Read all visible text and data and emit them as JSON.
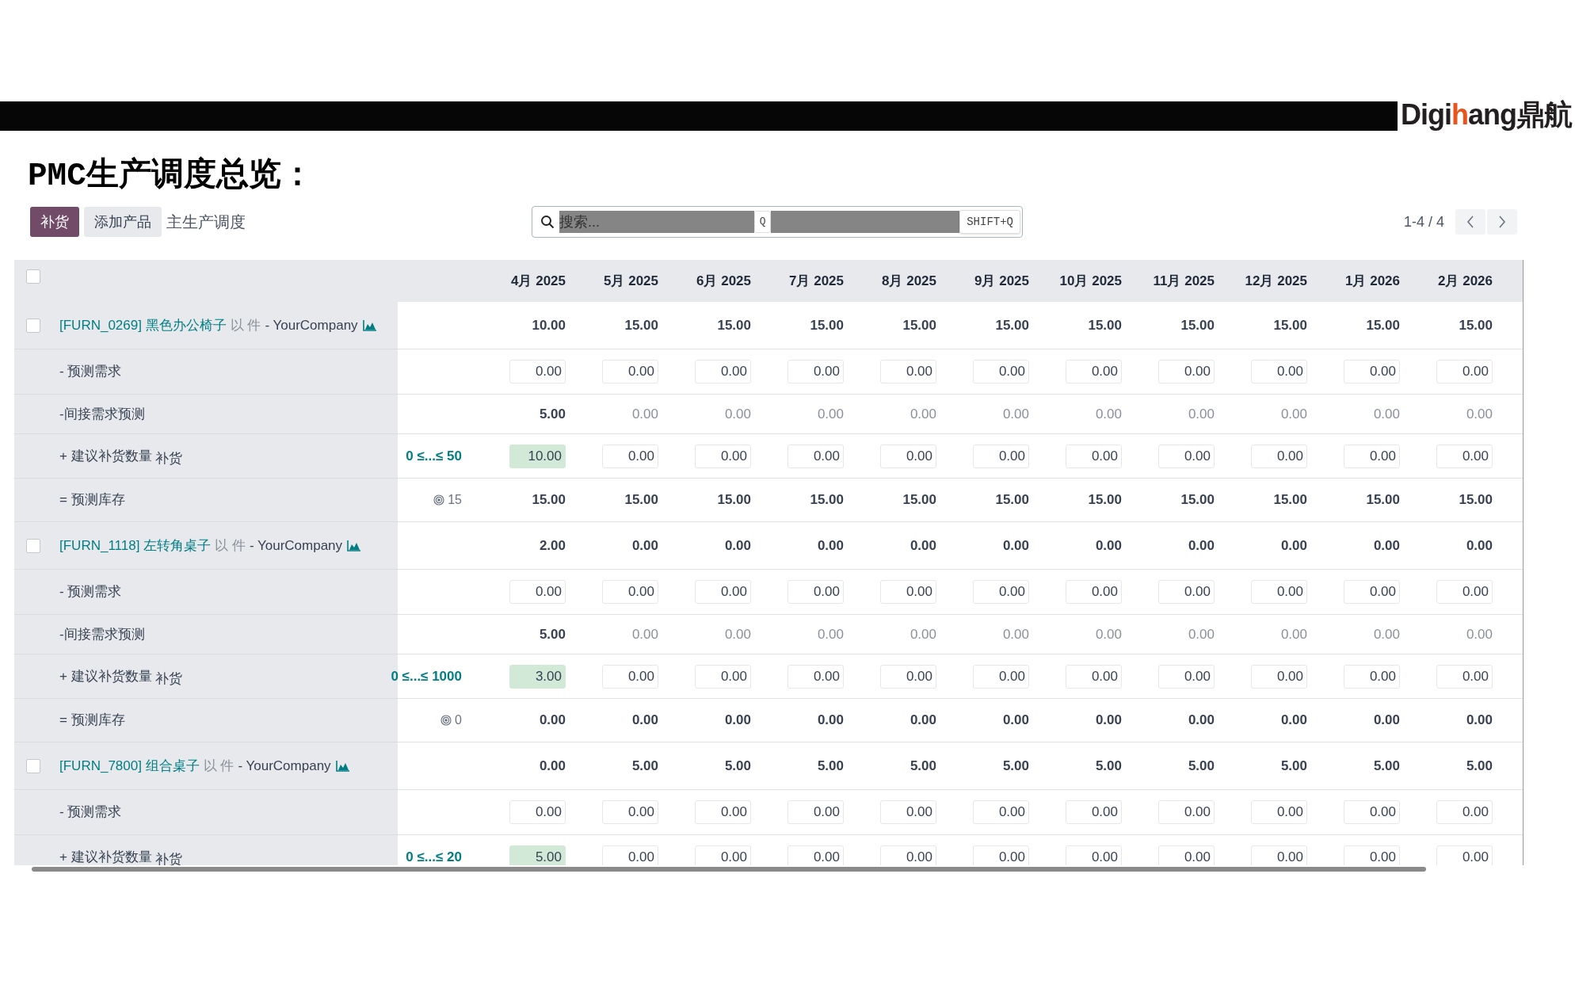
{
  "logo": {
    "parts": [
      {
        "text": "Digi",
        "color": "#231f20"
      },
      {
        "text": "h",
        "color": "#e8541c"
      },
      {
        "text": "ang",
        "color": "#231f20"
      },
      {
        "text": "鼎航",
        "color": "#231f20"
      }
    ]
  },
  "title": "PMC生产调度总览：",
  "toolbar": {
    "buttons": [
      {
        "label": "补货",
        "kind": "primary"
      },
      {
        "label": "添加产品",
        "kind": "secondary"
      }
    ],
    "breadcrumb": "主生产调度"
  },
  "search": {
    "placeholder": "搜索...",
    "key_hint": "Q",
    "shortcut": "SHIFT+Q"
  },
  "pager": {
    "range": "1-4 / 4"
  },
  "table": {
    "select_all_checked": false,
    "columns": [
      "4月 2025",
      "5月 2025",
      "6月 2025",
      "7月 2025",
      "8月 2025",
      "9月 2025",
      "10月 2025",
      "11月 2025",
      "12月 2025",
      "1月 2026",
      "2月 2026"
    ],
    "products": [
      {
        "code": "[FURN_0269]",
        "name": "黑色办公椅子",
        "uom": "以 件",
        "company": "- YourCompany",
        "checked": false,
        "values": [
          "10.00",
          "15.00",
          "15.00",
          "15.00",
          "15.00",
          "15.00",
          "15.00",
          "15.00",
          "15.00",
          "15.00",
          "15.00"
        ],
        "rows": [
          {
            "kind": "demand",
            "label": "- 预测需求",
            "cells": [
              {
                "text": "0.00"
              },
              {
                "text": "0.00"
              },
              {
                "text": "0.00"
              },
              {
                "text": "0.00"
              },
              {
                "text": "0.00"
              },
              {
                "text": "0.00"
              },
              {
                "text": "0.00"
              },
              {
                "text": "0.00"
              },
              {
                "text": "0.00"
              },
              {
                "text": "0.00"
              },
              {
                "text": "0.00"
              }
            ]
          },
          {
            "kind": "indirect",
            "label": "-间接需求预测",
            "cells": [
              {
                "text": "5.00",
                "muted": false
              },
              {
                "text": "0.00",
                "muted": true
              },
              {
                "text": "0.00",
                "muted": true
              },
              {
                "text": "0.00",
                "muted": true
              },
              {
                "text": "0.00",
                "muted": true
              },
              {
                "text": "0.00",
                "muted": true
              },
              {
                "text": "0.00",
                "muted": true
              },
              {
                "text": "0.00",
                "muted": true
              },
              {
                "text": "0.00",
                "muted": true
              },
              {
                "text": "0.00",
                "muted": true
              },
              {
                "text": "0.00",
                "muted": true
              }
            ]
          },
          {
            "kind": "replenish",
            "label": "+ 建议补货数量",
            "action": "补货",
            "range": "0 ≤...≤ 50",
            "cells": [
              {
                "text": "10.00",
                "highlighted": true
              },
              {
                "text": "0.00",
                "highlighted": false
              },
              {
                "text": "0.00",
                "highlighted": false
              },
              {
                "text": "0.00",
                "highlighted": false
              },
              {
                "text": "0.00",
                "highlighted": false
              },
              {
                "text": "0.00",
                "highlighted": false
              },
              {
                "text": "0.00",
                "highlighted": false
              },
              {
                "text": "0.00",
                "highlighted": false
              },
              {
                "text": "0.00",
                "highlighted": false
              },
              {
                "text": "0.00",
                "highlighted": false
              },
              {
                "text": "0.00",
                "highlighted": false
              }
            ]
          },
          {
            "kind": "forecast",
            "label": "= 预测库存",
            "safety_stock": "15",
            "cells": [
              {
                "text": "15.00"
              },
              {
                "text": "15.00"
              },
              {
                "text": "15.00"
              },
              {
                "text": "15.00"
              },
              {
                "text": "15.00"
              },
              {
                "text": "15.00"
              },
              {
                "text": "15.00"
              },
              {
                "text": "15.00"
              },
              {
                "text": "15.00"
              },
              {
                "text": "15.00"
              },
              {
                "text": "15.00"
              }
            ]
          }
        ]
      },
      {
        "code": "[FURN_1118]",
        "name": "左转角桌子",
        "uom": "以 件",
        "company": "- YourCompany",
        "checked": false,
        "values": [
          "2.00",
          "0.00",
          "0.00",
          "0.00",
          "0.00",
          "0.00",
          "0.00",
          "0.00",
          "0.00",
          "0.00",
          "0.00"
        ],
        "rows": [
          {
            "kind": "demand",
            "label": "- 预测需求",
            "cells": [
              {
                "text": "0.00"
              },
              {
                "text": "0.00"
              },
              {
                "text": "0.00"
              },
              {
                "text": "0.00"
              },
              {
                "text": "0.00"
              },
              {
                "text": "0.00"
              },
              {
                "text": "0.00"
              },
              {
                "text": "0.00"
              },
              {
                "text": "0.00"
              },
              {
                "text": "0.00"
              },
              {
                "text": "0.00"
              }
            ]
          },
          {
            "kind": "indirect",
            "label": "-间接需求预测",
            "cells": [
              {
                "text": "5.00",
                "muted": false
              },
              {
                "text": "0.00",
                "muted": true
              },
              {
                "text": "0.00",
                "muted": true
              },
              {
                "text": "0.00",
                "muted": true
              },
              {
                "text": "0.00",
                "muted": true
              },
              {
                "text": "0.00",
                "muted": true
              },
              {
                "text": "0.00",
                "muted": true
              },
              {
                "text": "0.00",
                "muted": true
              },
              {
                "text": "0.00",
                "muted": true
              },
              {
                "text": "0.00",
                "muted": true
              },
              {
                "text": "0.00",
                "muted": true
              }
            ]
          },
          {
            "kind": "replenish",
            "label": "+ 建议补货数量",
            "action": "补货",
            "range": "0 ≤...≤ 1000",
            "cells": [
              {
                "text": "3.00",
                "highlighted": true
              },
              {
                "text": "0.00",
                "highlighted": false
              },
              {
                "text": "0.00",
                "highlighted": false
              },
              {
                "text": "0.00",
                "highlighted": false
              },
              {
                "text": "0.00",
                "highlighted": false
              },
              {
                "text": "0.00",
                "highlighted": false
              },
              {
                "text": "0.00",
                "highlighted": false
              },
              {
                "text": "0.00",
                "highlighted": false
              },
              {
                "text": "0.00",
                "highlighted": false
              },
              {
                "text": "0.00",
                "highlighted": false
              },
              {
                "text": "0.00",
                "highlighted": false
              }
            ]
          },
          {
            "kind": "forecast",
            "label": "= 预测库存",
            "safety_stock": "0",
            "cells": [
              {
                "text": "0.00"
              },
              {
                "text": "0.00"
              },
              {
                "text": "0.00"
              },
              {
                "text": "0.00"
              },
              {
                "text": "0.00"
              },
              {
                "text": "0.00"
              },
              {
                "text": "0.00"
              },
              {
                "text": "0.00"
              },
              {
                "text": "0.00"
              },
              {
                "text": "0.00"
              },
              {
                "text": "0.00"
              }
            ]
          }
        ]
      },
      {
        "code": "[FURN_7800]",
        "name": "组合桌子",
        "uom": "以 件",
        "company": "- YourCompany",
        "checked": false,
        "values": [
          "0.00",
          "5.00",
          "5.00",
          "5.00",
          "5.00",
          "5.00",
          "5.00",
          "5.00",
          "5.00",
          "5.00",
          "5.00"
        ],
        "rows": [
          {
            "kind": "demand",
            "label": "- 预测需求",
            "cells": [
              {
                "text": "0.00"
              },
              {
                "text": "0.00"
              },
              {
                "text": "0.00"
              },
              {
                "text": "0.00"
              },
              {
                "text": "0.00"
              },
              {
                "text": "0.00"
              },
              {
                "text": "0.00"
              },
              {
                "text": "0.00"
              },
              {
                "text": "0.00"
              },
              {
                "text": "0.00"
              },
              {
                "text": "0.00"
              }
            ]
          },
          {
            "kind": "replenish",
            "label": "+ 建议补货数量",
            "action": "补货",
            "range": "0 ≤...≤ 20",
            "cells": [
              {
                "text": "5.00",
                "highlighted": true
              },
              {
                "text": "0.00",
                "highlighted": false
              },
              {
                "text": "0.00",
                "highlighted": false
              },
              {
                "text": "0.00",
                "highlighted": false
              },
              {
                "text": "0.00",
                "highlighted": false
              },
              {
                "text": "0.00",
                "highlighted": false
              },
              {
                "text": "0.00",
                "highlighted": false
              },
              {
                "text": "0.00",
                "highlighted": false
              },
              {
                "text": "0.00",
                "highlighted": false
              },
              {
                "text": "0.00",
                "highlighted": false
              },
              {
                "text": "0.00",
                "highlighted": false
              }
            ]
          }
        ]
      }
    ]
  }
}
